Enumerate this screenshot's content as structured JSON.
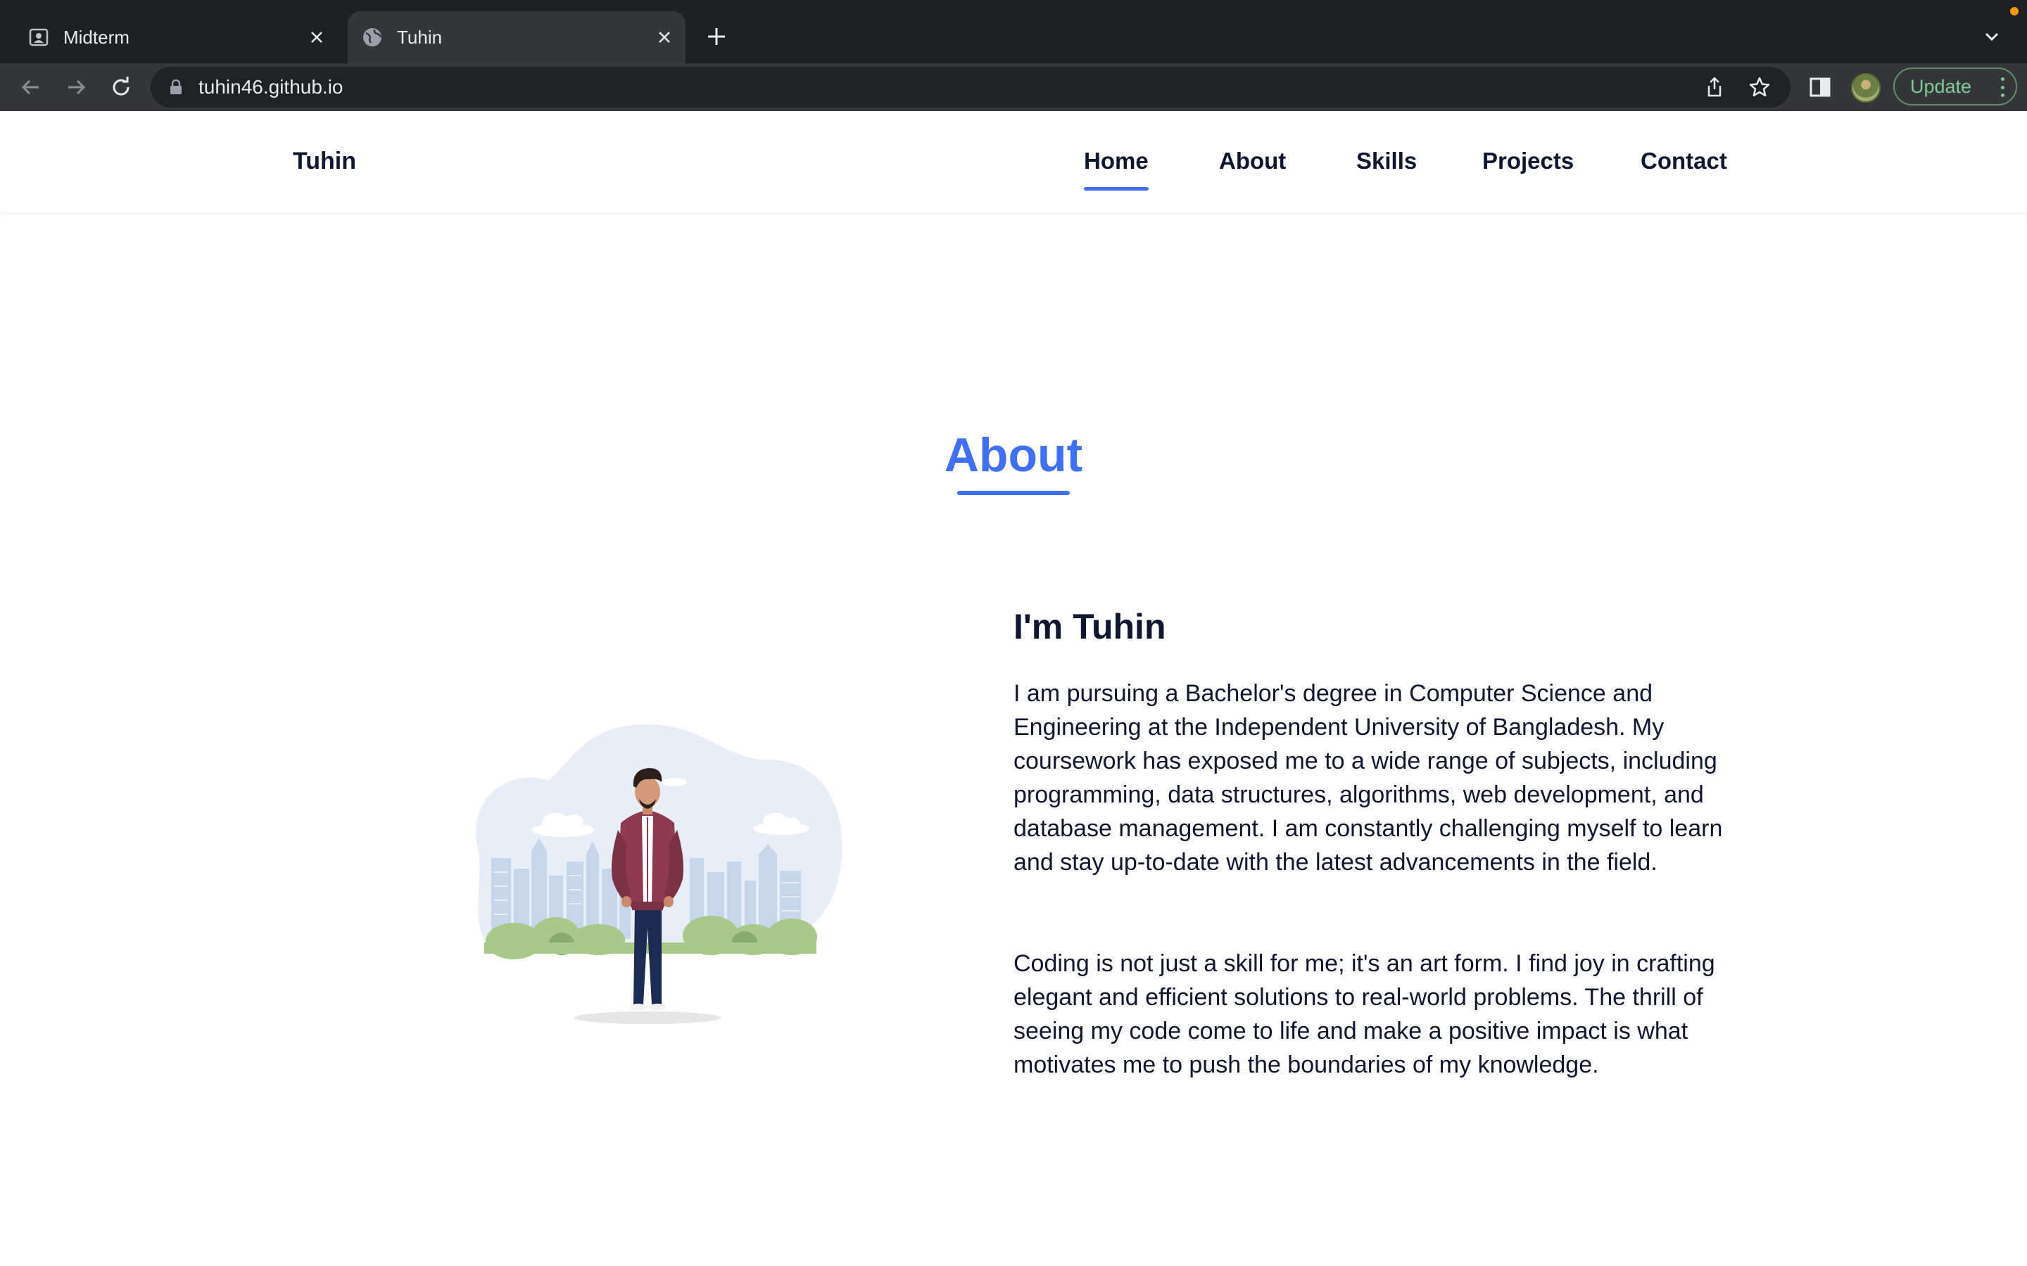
{
  "browser": {
    "tabs": [
      {
        "title": "Midterm",
        "icon": "contact-card-icon",
        "active": false
      },
      {
        "title": "Tuhin",
        "icon": "globe-icon",
        "active": true
      }
    ],
    "url": "tuhin46.github.io",
    "update_label": "Update"
  },
  "site": {
    "logo": "Tuhin",
    "nav": [
      "Home",
      "About",
      "Skills",
      "Projects",
      "Contact"
    ],
    "active_nav": "Home",
    "accent": "#4070f4",
    "text_color": "#0e1630"
  },
  "about": {
    "section_title": "About",
    "heading": "I'm Tuhin",
    "paragraphs": [
      "I am pursuing a Bachelor's degree in Computer Science and Engineering at the Independent University of Bangladesh. My coursework has exposed me to a wide range of subjects, including programming, data structures, algorithms, web development, and database management. I am constantly challenging myself to learn and stay up-to-date with the latest advancements in the field.",
      "Coding is not just a skill for me; it's an art form. I find joy in crafting elegant and efficient solutions to real-world problems. The thrill of seeing my code come to life and make a positive impact is what motivates me to push the boundaries of my knowledge."
    ]
  }
}
